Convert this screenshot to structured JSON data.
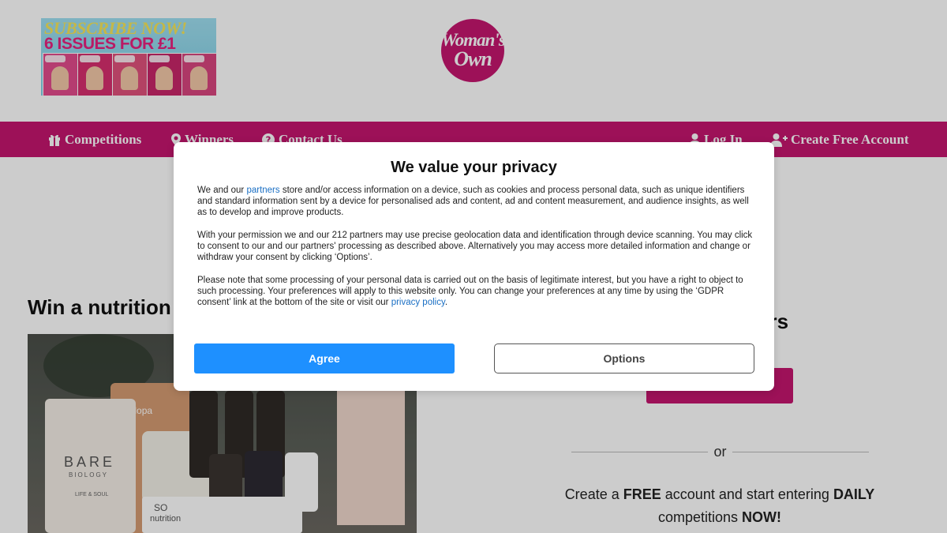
{
  "header": {
    "promo": {
      "line1": "SUBSCRIBE NOW!",
      "line2": "6 ISSUES FOR £1"
    },
    "logo": {
      "line1": "Woman's",
      "line2": "Own"
    }
  },
  "nav": {
    "competitions": "Competitions",
    "winners": "Winners",
    "contact": "Contact Us",
    "login": "Log In",
    "create_account": "Create Free Account"
  },
  "main": {
    "article_title": "Win a nutrition",
    "right_heading": "ers",
    "or_text": "or",
    "signup": {
      "pre": "Create a",
      "free": "FREE",
      "mid": "account and start entering",
      "daily": "DAILY",
      "post": "competitions",
      "now": "NOW!"
    },
    "photo": {
      "bare_brand": "BARE",
      "bare_sub": "BIOLOGY",
      "bare_line": "LIFE & SOUL",
      "tub_label": "et dopa",
      "so_brand": "SO",
      "so_sub": "nutrition"
    }
  },
  "consent": {
    "title": "We value your privacy",
    "p1_pre": "We and our",
    "p1_link": "partners",
    "p1_post": "store and/or access information on a device, such as cookies and process personal data, such as unique identifiers and standard information sent by a device for personalised ads and content, ad and content measurement, and audience insights, as well as to develop and improve products.",
    "p2": "With your permission we and our 212 partners may use precise geolocation data and identification through device scanning. You may click to consent to our and our partners' processing as described above. Alternatively you may access more detailed information and change or withdraw your consent by clicking ‘Options’.",
    "p3_pre": "Please note that some processing of your personal data is carried out on the basis of legitimate interest, but you have a right to object to such processing. Your preferences will apply to this website only. You can change your preferences at any time by using the ‘GDPR consent’ link at the bottom of the site or visit our",
    "p3_link": "privacy policy",
    "p3_post": ".",
    "agree_label": "Agree",
    "options_label": "Options"
  },
  "colors": {
    "brand": "#c5166f",
    "agree": "#1e90ff",
    "link": "#1a6fc4"
  }
}
